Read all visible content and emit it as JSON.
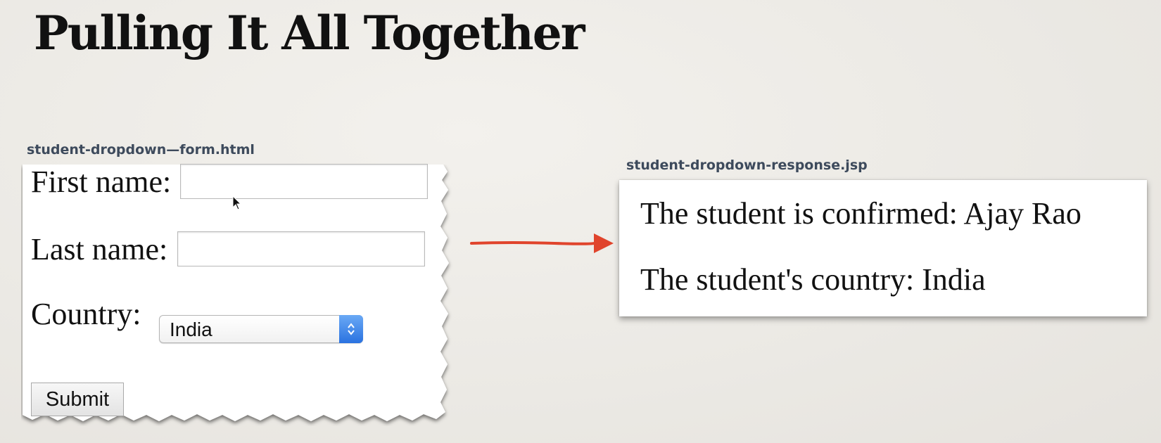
{
  "slide": {
    "title": "Pulling It All Together"
  },
  "form_panel": {
    "file_label": "student-dropdown—form.html",
    "first_name_label": "First name:",
    "first_name_value": "",
    "last_name_label": "Last name:",
    "last_name_value": "",
    "country_label": "Country:",
    "country_selected": "India",
    "submit_label": "Submit"
  },
  "response_panel": {
    "file_label": "student-dropdown-response.jsp",
    "confirmed_line": "The student is confirmed: Ajay Rao",
    "country_line": "The student's country: India"
  },
  "colors": {
    "arrow": "#e0442c",
    "select_accent": "#3b82ea",
    "label_text": "#3d4a5c"
  }
}
